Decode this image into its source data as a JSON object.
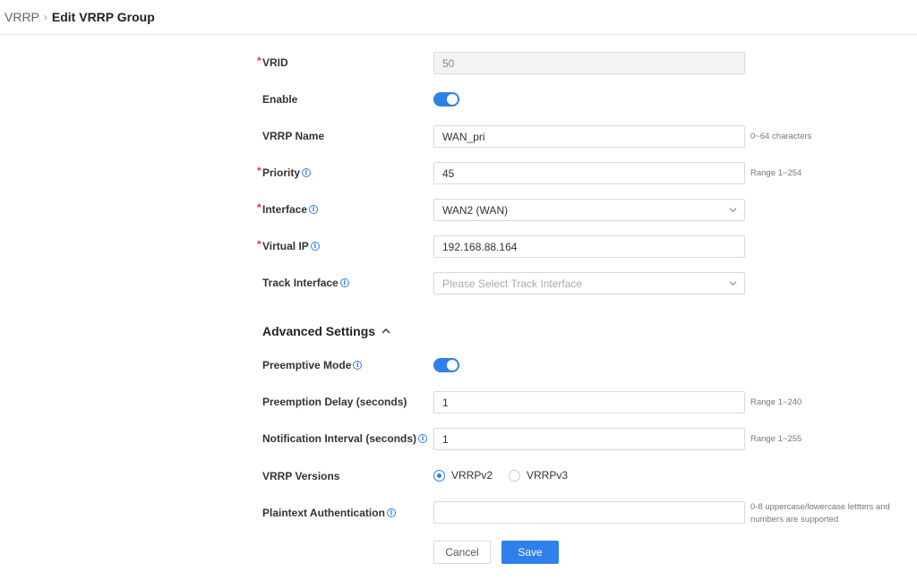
{
  "breadcrumb": {
    "parent": "VRRP",
    "current": "Edit VRRP Group"
  },
  "form": {
    "vrid": {
      "label": "VRID",
      "value": "50"
    },
    "enable": {
      "label": "Enable",
      "on": true
    },
    "vrrp_name": {
      "label": "VRRP Name",
      "value": "WAN_pri",
      "hint": "0~64 characters"
    },
    "priority": {
      "label": "Priority",
      "value": "45",
      "hint": "Range 1~254"
    },
    "interface": {
      "label": "Interface",
      "value": "WAN2 (WAN)"
    },
    "virtual_ip": {
      "label": "Virtual IP",
      "value": "192.168.88.164"
    },
    "track_interface": {
      "label": "Track Interface",
      "placeholder": "Please Select Track Interface"
    }
  },
  "advanced": {
    "title": "Advanced Settings",
    "preemptive_mode": {
      "label": "Preemptive Mode",
      "on": true
    },
    "preemption_delay": {
      "label": "Preemption Delay (seconds)",
      "value": "1",
      "hint": "Range 1~240"
    },
    "notification_interval": {
      "label": "Notification Interval (seconds)",
      "value": "1",
      "hint": "Range 1~255"
    },
    "vrrp_versions": {
      "label": "VRRP Versions",
      "options": [
        "VRRPv2",
        "VRRPv3"
      ],
      "selected": "VRRPv2"
    },
    "plaintext_auth": {
      "label": "Plaintext Authentication",
      "value": "",
      "hint_line1": "0-8 uppercase/lowercase lettters and",
      "hint_line2": "numbers are supported"
    }
  },
  "actions": {
    "cancel": "Cancel",
    "save": "Save"
  },
  "required_mark": "*",
  "info_glyph": "i",
  "colors": {
    "accent": "#2f80ed",
    "required": "#e53935"
  }
}
